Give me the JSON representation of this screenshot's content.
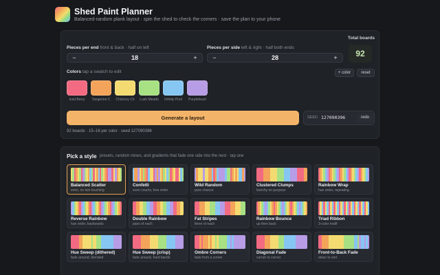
{
  "app": {
    "title": "Shed Paint Planner",
    "subtitle": "Balanced-random plank layout · spin the shed to check the corners · save the plan to your phone"
  },
  "config": {
    "per_end": {
      "label": "Pieces per end",
      "hint": "front & back · half on left",
      "value": "18",
      "minus": "−",
      "plus": "+"
    },
    "per_side": {
      "label": "Pieces per side",
      "hint": "left & right · half both ends",
      "value": "28",
      "minus": "−",
      "plus": "+"
    },
    "total": {
      "label": "Total boards",
      "value": "92"
    },
    "colors": {
      "label": "Colors",
      "hint": "tap a swatch to edit",
      "add_label": "+ color",
      "reset_label": "reset",
      "items": [
        {
          "name": "Iced Berry",
          "hex": "#f26b82"
        },
        {
          "name": "Tangerine C",
          "hex": "#f3a45a"
        },
        {
          "name": "Chickory Ch",
          "hex": "#f3db72"
        },
        {
          "name": "Lush Meado",
          "hex": "#a8e084"
        },
        {
          "name": "Infinity Pool",
          "hex": "#86c6f2"
        },
        {
          "name": "Purpleheart",
          "hex": "#b79ce6"
        }
      ]
    },
    "generate_label": "Generate a layout",
    "seed": {
      "label": "SEED",
      "value": "127090396",
      "redo_label": "redo"
    },
    "status": "92 boards · 15–16 per color · seed 127090396"
  },
  "styles": {
    "title": "Pick a style",
    "hint": "presets, random mixes, and gradients that fade one side into the next · tap one",
    "tiles": [
      {
        "name": "Balanced Scatter",
        "desc": "even, no two touching",
        "selected": true
      },
      {
        "name": "Confetti",
        "desc": "even counts, free order"
      },
      {
        "name": "Wild Random",
        "desc": "pure chance"
      },
      {
        "name": "Clustered Clumps",
        "desc": "bunchy on purpose"
      },
      {
        "name": "Rainbow Wrap",
        "desc": "hue order, repeating"
      },
      {
        "name": "Reverse Rainbow",
        "desc": "hue order, backwards"
      },
      {
        "name": "Double Rainbow",
        "desc": "pairs of each"
      },
      {
        "name": "Fat Stripes",
        "desc": "three of each"
      },
      {
        "name": "Rainbow Bounce",
        "desc": "up then back"
      },
      {
        "name": "Triad Ribbon",
        "desc": "3-color motif"
      },
      {
        "name": "Hue Sweep (dithered)",
        "desc": "fade around, blended"
      },
      {
        "name": "Hue Sweep (crisp)",
        "desc": "fade around, hard bands"
      },
      {
        "name": "Ombre Corners",
        "desc": "fade from a corner"
      },
      {
        "name": "Diagonal Fade",
        "desc": "corner to corner"
      },
      {
        "name": "Front-to-Back Fade",
        "desc": "down to vert"
      }
    ]
  }
}
